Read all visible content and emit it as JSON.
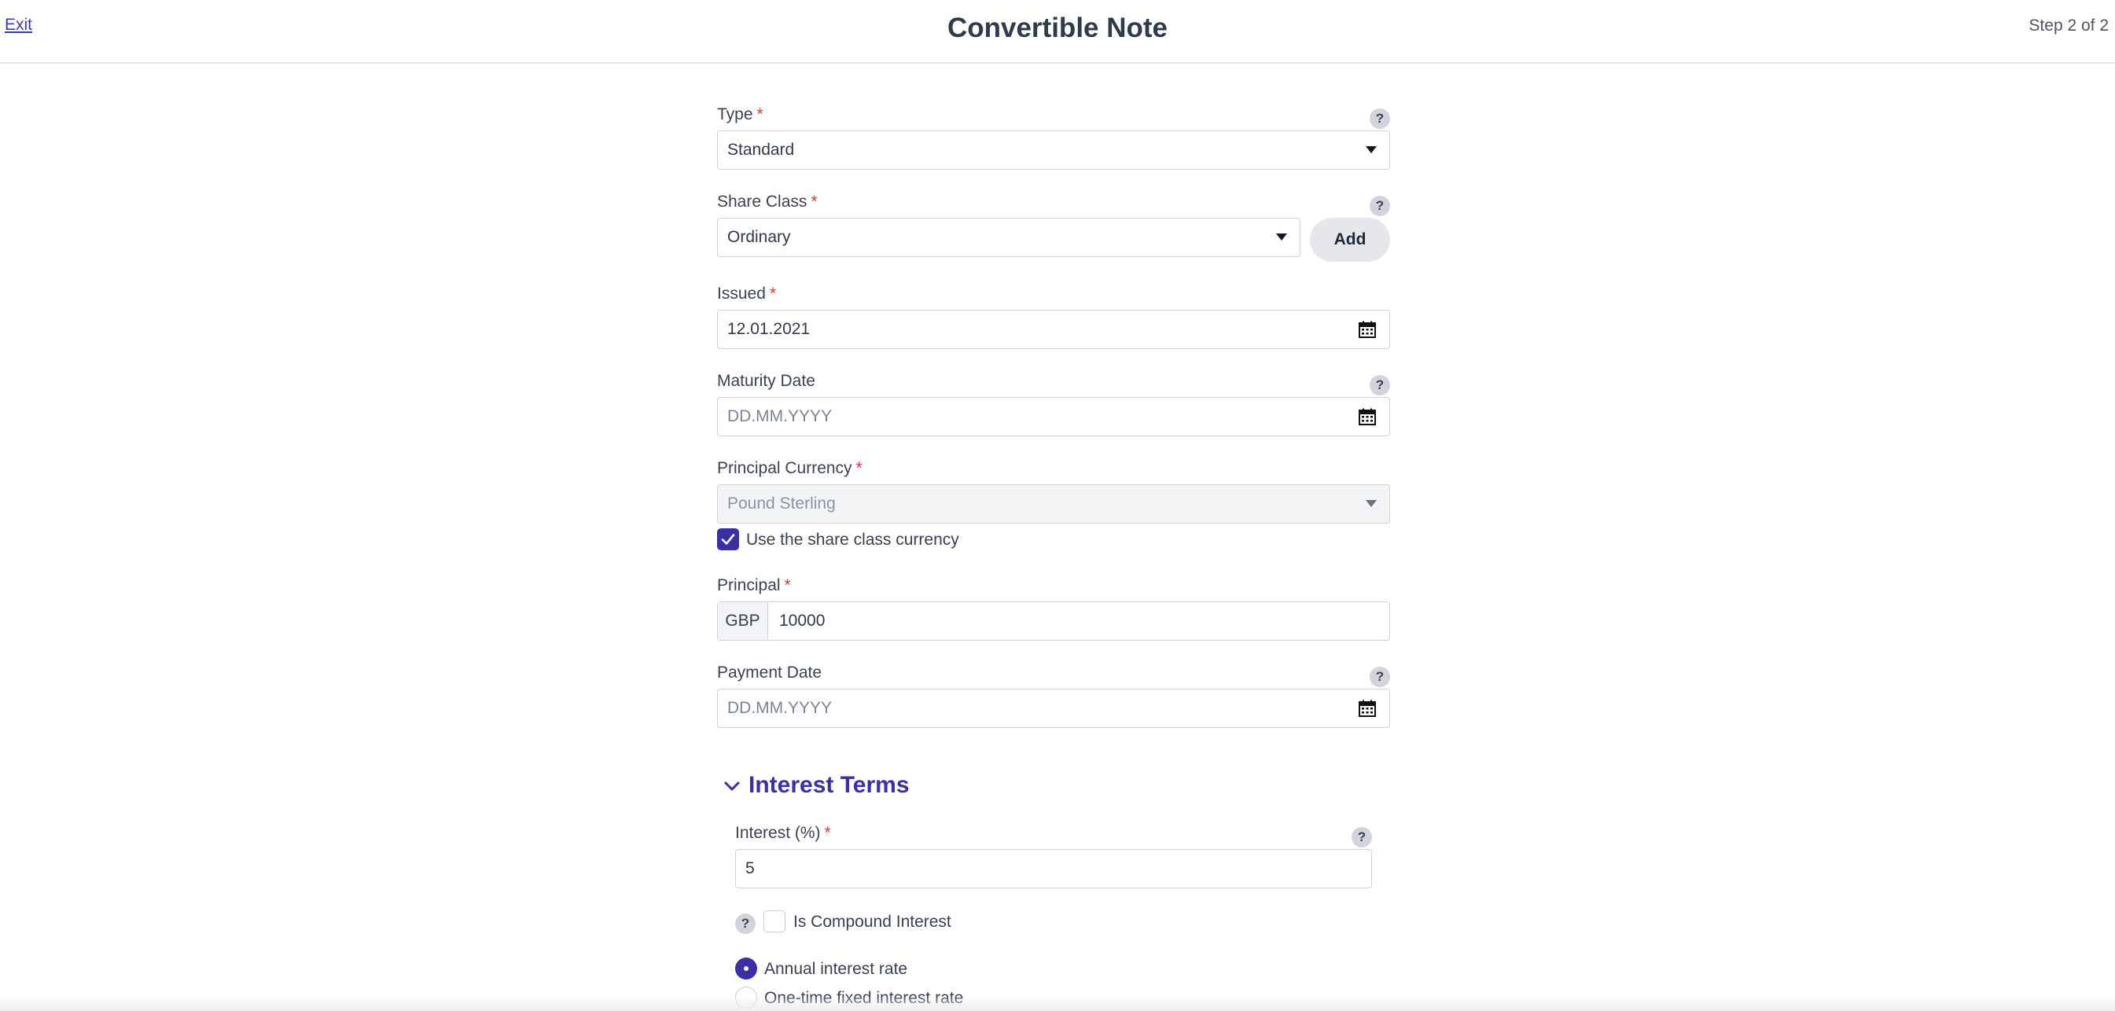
{
  "header": {
    "exit_label": "Exit",
    "title": "Convertible Note",
    "step": "Step 2 of 2"
  },
  "fields": {
    "type": {
      "label": "Type",
      "value": "Standard"
    },
    "share_class": {
      "label": "Share Class",
      "value": "Ordinary",
      "add_label": "Add"
    },
    "issued": {
      "label": "Issued",
      "value": "12.01.2021"
    },
    "maturity_date": {
      "label": "Maturity Date",
      "placeholder": "DD.MM.YYYY"
    },
    "principal_currency": {
      "label": "Principal Currency",
      "value": "Pound Sterling",
      "checkbox_label": "Use the share class currency",
      "checkbox_checked": true
    },
    "principal": {
      "label": "Principal",
      "prefix": "GBP",
      "value": "10000"
    },
    "payment_date": {
      "label": "Payment Date",
      "placeholder": "DD.MM.YYYY"
    }
  },
  "interest_terms": {
    "heading": "Interest Terms",
    "interest": {
      "label": "Interest (%)",
      "value": "5"
    },
    "compound": {
      "label": "Is Compound Interest",
      "checked": false
    },
    "options": [
      {
        "label": "Annual interest rate",
        "selected": true
      },
      {
        "label": "One-time fixed interest rate",
        "selected": false
      }
    ]
  },
  "required_marker": "*",
  "help_glyph": "?",
  "colors": {
    "accent": "#3a2fa3",
    "required": "#d63a3a",
    "border": "#cfd4dc"
  }
}
